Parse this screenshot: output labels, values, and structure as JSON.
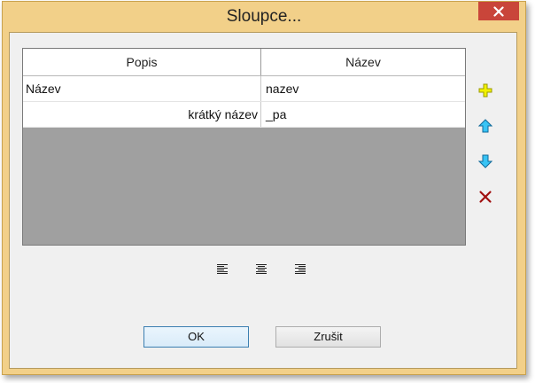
{
  "window": {
    "title": "Sloupce..."
  },
  "grid": {
    "columns": [
      "Popis",
      "Název"
    ],
    "rows": [
      {
        "popis": "Název",
        "nazev": "nazev"
      },
      {
        "popis": "krátký název",
        "nazev": "_pa"
      }
    ]
  },
  "side_tools": [
    {
      "icon": "add-icon",
      "color": "#e8e800"
    },
    {
      "icon": "move-up-icon",
      "color": "#2fb8f0"
    },
    {
      "icon": "move-down-icon",
      "color": "#2fb8f0"
    },
    {
      "icon": "delete-icon",
      "color": "#a01010"
    }
  ],
  "alignment_tools": [
    "align-left-icon",
    "align-center-icon",
    "align-right-icon"
  ],
  "buttons": {
    "ok_label": "OK",
    "cancel_label": "Zrušit"
  },
  "colors": {
    "title_bar": "#f2d089",
    "close_button": "#c9453a",
    "grid_empty_area": "#a0a0a0",
    "dialog_background": "#f0f0f0"
  }
}
